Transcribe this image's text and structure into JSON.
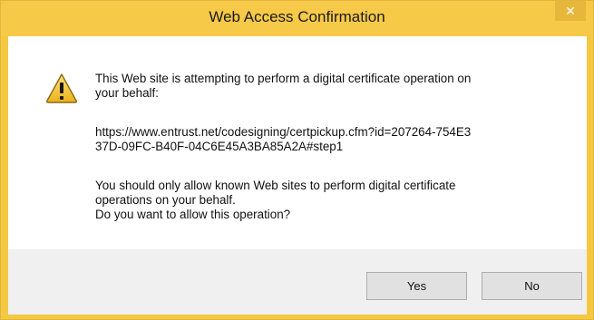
{
  "window": {
    "title": "Web Access Confirmation",
    "close_glyph": "✕"
  },
  "message": {
    "intro": [
      "This Web site is attempting to perform a digital certificate operation on",
      "your behalf:"
    ],
    "url": [
      "https://www.entrust.net/codesigning/certpickup.cfm?id=207264-754E3",
      "37D-09FC-B40F-04C6E45A3BA85A2A#step1"
    ],
    "advice": [
      "You should only allow known Web sites to perform digital certificate",
      "operations on your behalf.",
      "Do you want to allow this operation?"
    ]
  },
  "buttons": {
    "yes": "Yes",
    "no": "No"
  },
  "icons": {
    "warning": "warning-icon"
  },
  "colors": {
    "titlebar": "#f7c948",
    "close_button": "#e6b73a",
    "footer": "#f0f0f0"
  }
}
